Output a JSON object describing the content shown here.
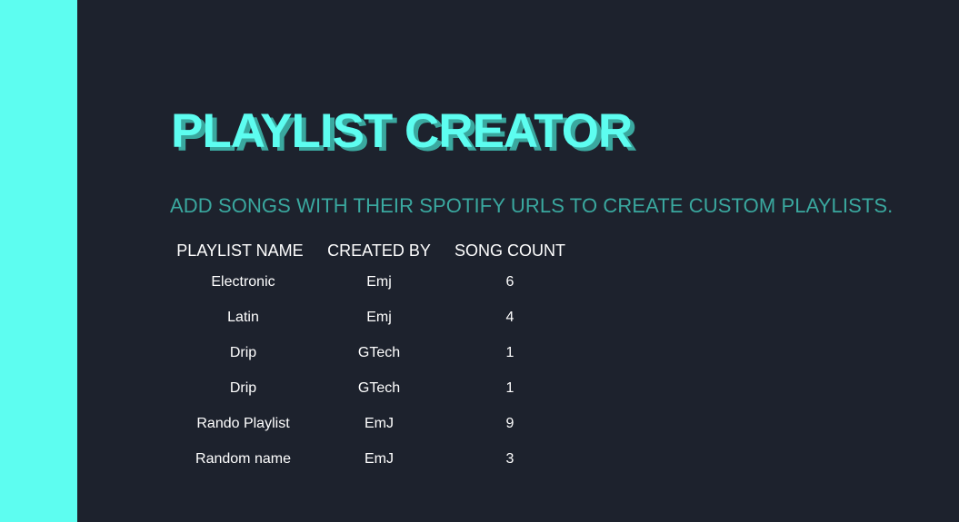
{
  "colors": {
    "accent": "#5dfdf0",
    "accent_dark": "#3aa89f",
    "background": "#1d222d",
    "text": "#ffffff"
  },
  "header": {
    "title": "PLAYLIST CREATOR",
    "subtitle": "ADD SONGS WITH THEIR SPOTIFY URLS TO CREATE CUSTOM PLAYLISTS."
  },
  "table": {
    "columns": [
      "PLAYLIST NAME",
      "CREATED BY",
      "SONG COUNT"
    ],
    "rows": [
      {
        "name": "Electronic",
        "creator": "Emj",
        "count": "6"
      },
      {
        "name": "Latin",
        "creator": "Emj",
        "count": "4"
      },
      {
        "name": "Drip",
        "creator": "GTech",
        "count": "1"
      },
      {
        "name": "Drip",
        "creator": "GTech",
        "count": "1"
      },
      {
        "name": "Rando Playlist",
        "creator": "EmJ",
        "count": "9"
      },
      {
        "name": "Random name",
        "creator": "EmJ",
        "count": "3"
      }
    ]
  }
}
